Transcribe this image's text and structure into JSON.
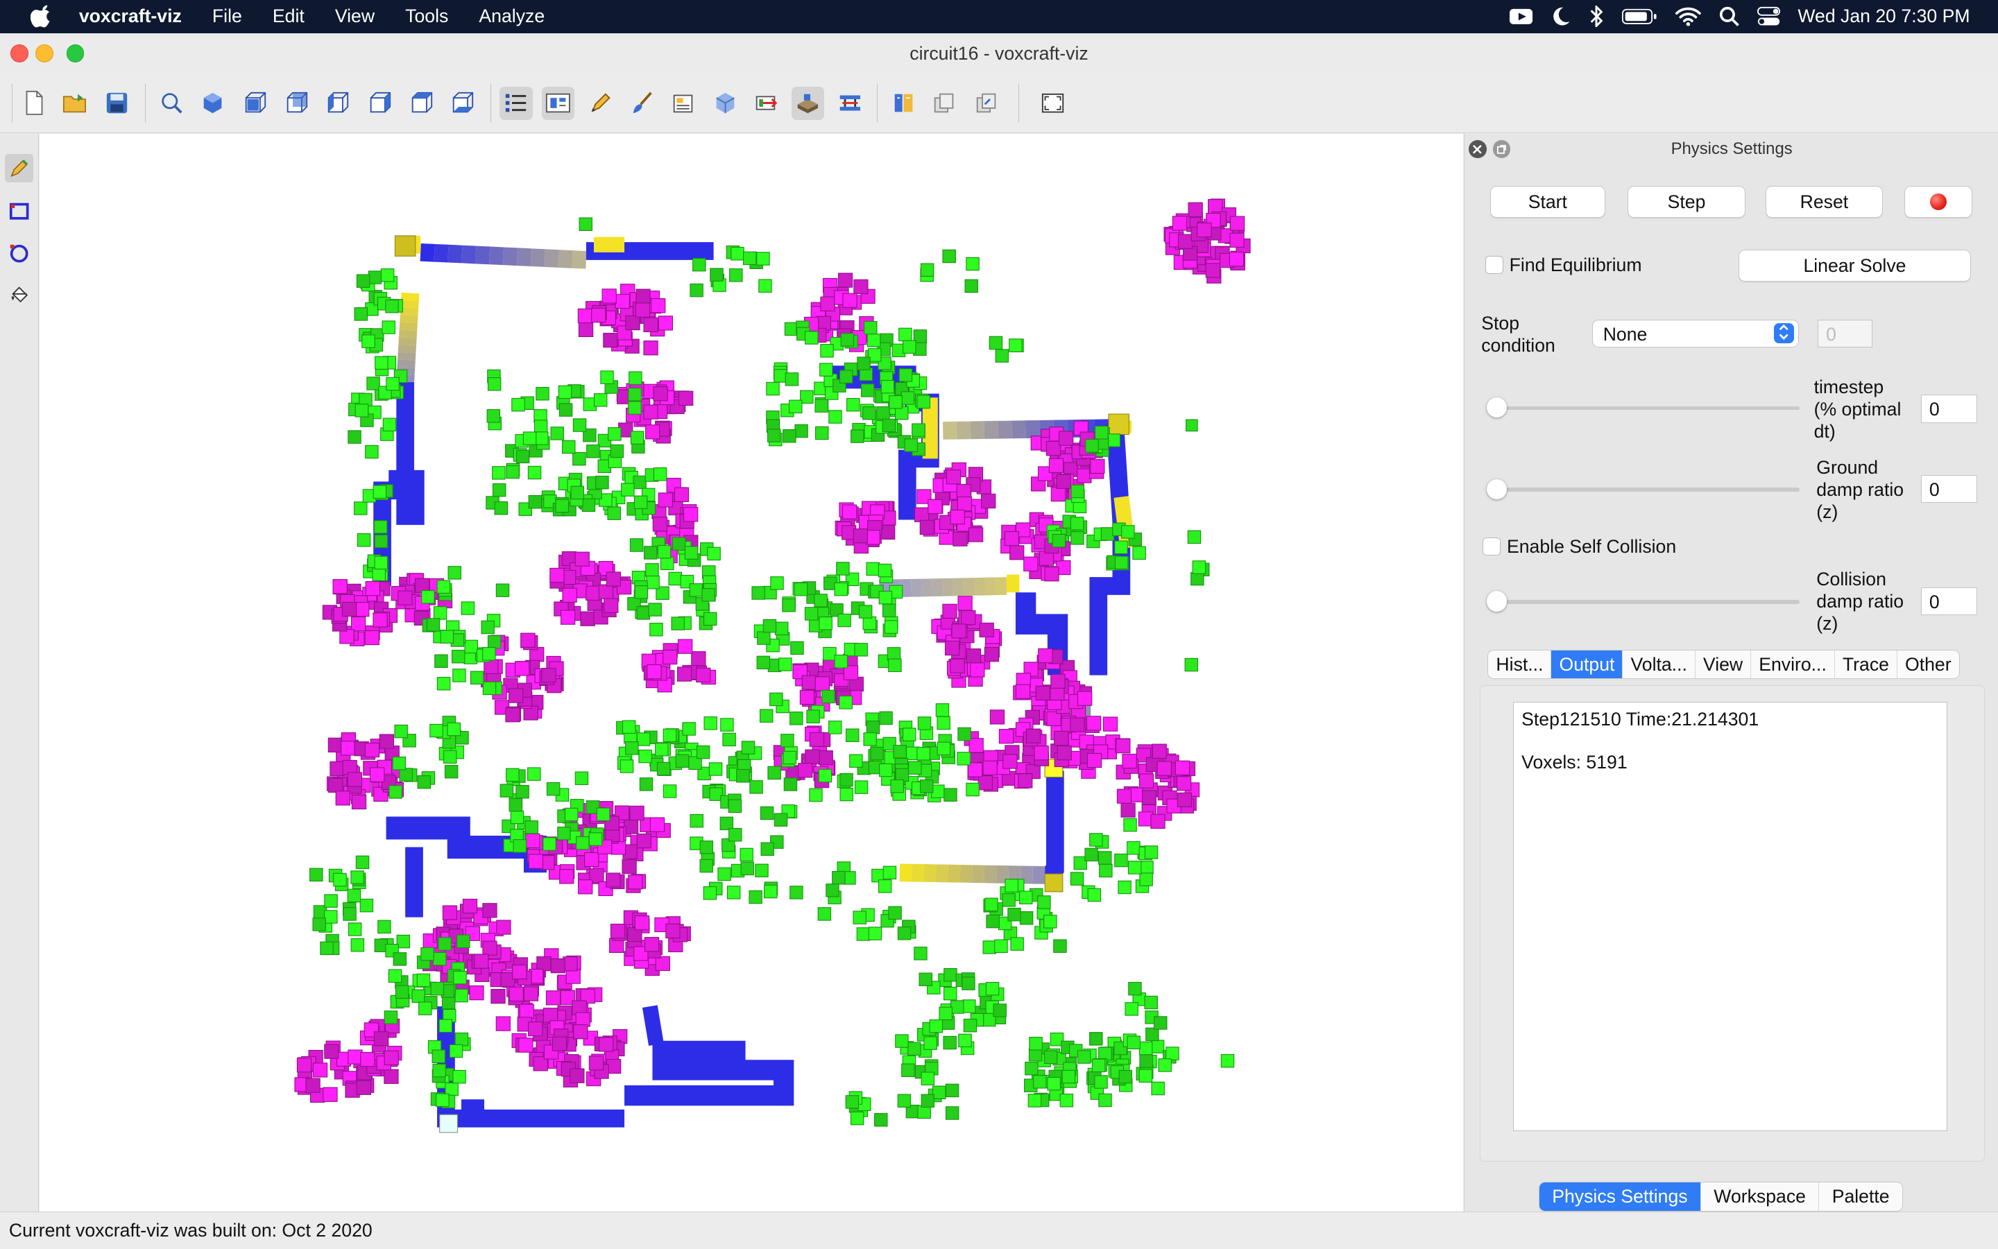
{
  "menubar": {
    "app_name": "voxcraft-viz",
    "items": [
      "File",
      "Edit",
      "View",
      "Tools",
      "Analyze"
    ],
    "clock": "Wed Jan 20  7:30 PM",
    "status_icons": [
      "video-icon",
      "moon-icon",
      "bluetooth-icon",
      "battery-icon",
      "wifi-icon",
      "search-icon",
      "control-center-icon"
    ]
  },
  "window": {
    "title": "circuit16 - voxcraft-viz"
  },
  "toolbar": {
    "buttons": [
      "new-file-icon",
      "open-folder-icon",
      "save-icon",
      "zoom-fit-icon",
      "view-perspective-icon",
      "view-front-icon",
      "view-back-icon",
      "view-left-icon",
      "view-right-icon",
      "view-top-icon",
      "view-bottom-icon",
      "list-icon",
      "palette-icon",
      "pencil-icon",
      "brush-icon",
      "structure-icon",
      "cube-icon",
      "export-icon",
      "physics-sandbox-icon",
      "workspace-icon",
      "book-icon",
      "copy-icon",
      "paste-icon",
      "fullscreen-icon"
    ]
  },
  "left_tools": [
    "pencil-icon",
    "rectangle-icon",
    "ellipse-icon",
    "paint-bucket-icon"
  ],
  "physics_panel": {
    "title": "Physics Settings",
    "start_label": "Start",
    "step_label": "Step",
    "reset_label": "Reset",
    "record_color": "#e8231a",
    "find_equilibrium_label": "Find Equilibrium",
    "linear_solve_label": "Linear Solve",
    "stop_condition_label_1": "Stop",
    "stop_condition_label_2": "condition",
    "stop_condition_value": "None",
    "stop_condition_number": "0",
    "timestep_label_1": "timestep",
    "timestep_label_2": "(% optimal",
    "timestep_label_3": "dt)",
    "timestep_value": "0",
    "timestep_level": 0,
    "ground_damp_label_1": "Ground",
    "ground_damp_label_2": "damp ratio",
    "ground_damp_label_3": "(z)",
    "ground_damp_value": "0",
    "ground_damp_level": 0,
    "self_collision_label": "Enable Self Collision",
    "collision_damp_label_1": "Collision",
    "collision_damp_label_2": "damp ratio",
    "collision_damp_label_3": "(z)",
    "collision_damp_value": "0",
    "collision_damp_level": 0,
    "tabs": [
      "Hist...",
      "Output",
      "Volta...",
      "View",
      "Enviro...",
      "Trace",
      "Other"
    ],
    "selected_tab": "Output",
    "output_line_1": "Step121510 Time:21.214301",
    "output_line_2": "Voxels: 5191"
  },
  "bottom_tabs": [
    "Physics Settings",
    "Workspace",
    "Palette"
  ],
  "selected_bottom_tab": "Physics Settings",
  "status_bar": "Current voxcraft-viz was built on: Oct  2 2020",
  "colors": {
    "voxel_magenta": "#ee1ee6",
    "voxel_green": "#2cf21e",
    "voxel_blue": "#2d2de8",
    "voxel_yellow": "#f3e225",
    "accent_blue": "#2f7cf6"
  }
}
